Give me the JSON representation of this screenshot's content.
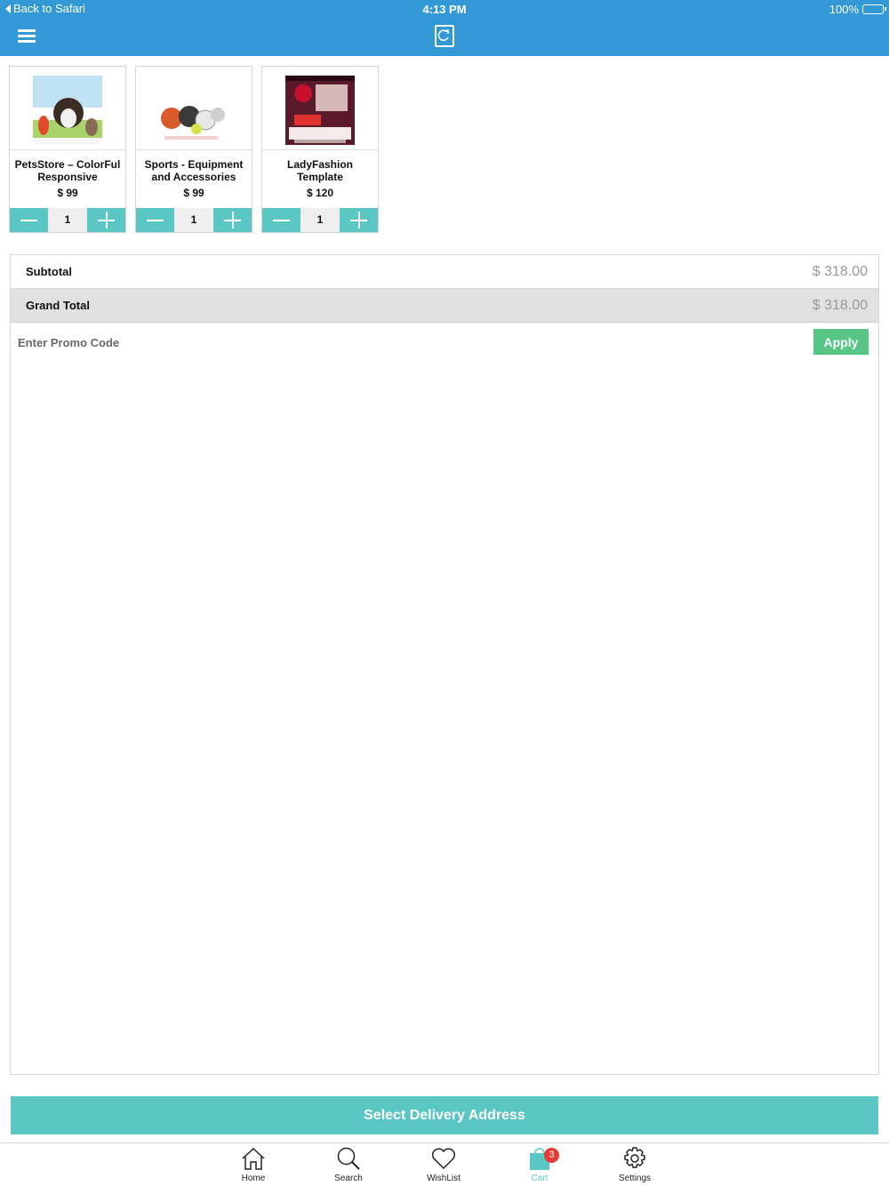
{
  "status_bar": {
    "back_label": "Back to Safari",
    "time": "4:13 PM",
    "battery": "100%"
  },
  "header": {
    "menu_icon": "hamburger-menu-icon",
    "logo_icon": "app-logo-icon"
  },
  "colors": {
    "header": "#3399d6",
    "accent": "#5bc7c5",
    "apply": "#57c584",
    "badge": "#e53935"
  },
  "products": [
    {
      "name": "PetsStore – ColorFul Responsive Magento…",
      "price": "$ 99",
      "qty": "1"
    },
    {
      "name": "Sports - Equipment and Accessories Mag…",
      "price": "$ 99",
      "qty": "1"
    },
    {
      "name": "LadyFashion Template",
      "price": "$ 120",
      "qty": "1"
    }
  ],
  "totals": {
    "subtotal_label": "Subtotal",
    "subtotal_value": "$ 318.00",
    "grand_label": "Grand Total",
    "grand_value": "$ 318.00"
  },
  "promo": {
    "placeholder": "Enter Promo Code",
    "apply_label": "Apply"
  },
  "delivery_label": "Select Delivery Address",
  "tabs": {
    "home": "Home",
    "search": "Search",
    "wishlist": "WishList",
    "cart": "Cart",
    "settings": "Settings",
    "cart_badge": "3"
  }
}
